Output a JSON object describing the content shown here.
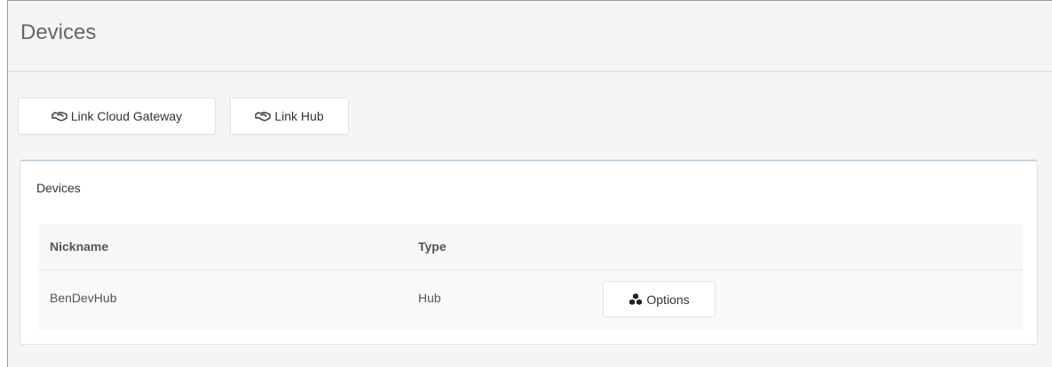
{
  "page": {
    "title": "Devices"
  },
  "toolbar": {
    "link_gateway_label": "Link Cloud Gateway",
    "link_hub_label": "Link Hub",
    "link_icon": "handshake-icon"
  },
  "panel": {
    "title": "Devices",
    "table": {
      "headers": [
        "Nickname",
        "Type"
      ],
      "rows": [
        {
          "nickname": "BenDevHub",
          "type": "Hub",
          "action_label": "Options",
          "action_icon": "cubes-icon"
        }
      ]
    }
  },
  "colors": {
    "page_bg": "#f5f5f5",
    "panel_border": "#d9e2ec",
    "text": "#333333",
    "title_text": "#666666"
  }
}
